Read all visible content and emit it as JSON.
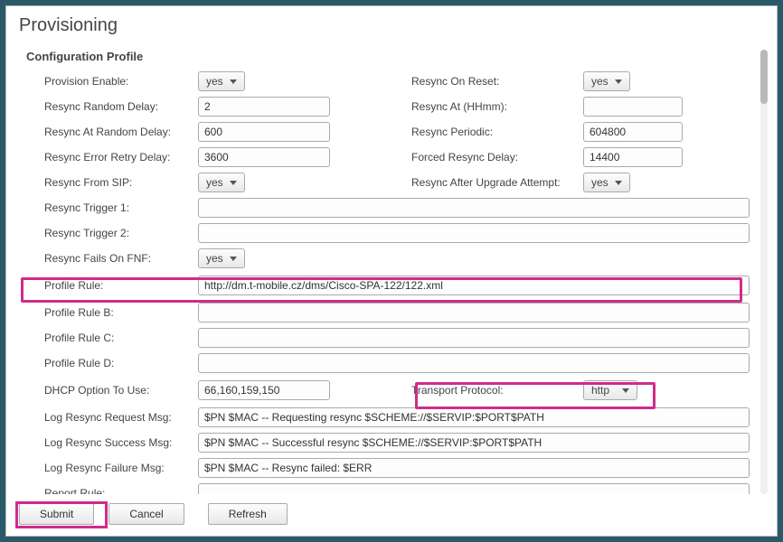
{
  "title": "Provisioning",
  "section": "Configuration Profile",
  "options": {
    "yes": "yes",
    "http": "http"
  },
  "labels": {
    "provisionEnable": "Provision Enable:",
    "resyncOnReset": "Resync On Reset:",
    "resyncRandomDelay": "Resync Random Delay:",
    "resyncAt": "Resync At (HHmm):",
    "resyncAtRandomDelay": "Resync At Random Delay:",
    "resyncPeriodic": "Resync Periodic:",
    "resyncErrorRetryDelay": "Resync Error Retry Delay:",
    "forcedResyncDelay": "Forced Resync Delay:",
    "resyncFromSip": "Resync From SIP:",
    "resyncAfterUpgrade": "Resync After Upgrade Attempt:",
    "resyncTrigger1": "Resync Trigger 1:",
    "resyncTrigger2": "Resync Trigger 2:",
    "resyncFailsOnFnf": "Resync Fails On FNF:",
    "profileRule": "Profile Rule:",
    "profileRuleB": "Profile Rule B:",
    "profileRuleC": "Profile Rule C:",
    "profileRuleD": "Profile Rule D:",
    "dhcpOption": "DHCP Option To Use:",
    "transportProtocol": "Transport Protocol:",
    "logReq": "Log Resync Request Msg:",
    "logSucc": "Log Resync Success Msg:",
    "logFail": "Log Resync Failure Msg:",
    "reportRule": "Report Rule:"
  },
  "values": {
    "resyncRandomDelay": "2",
    "resyncAt": "",
    "resyncAtRandomDelay": "600",
    "resyncPeriodic": "604800",
    "resyncErrorRetryDelay": "3600",
    "forcedResyncDelay": "14400",
    "resyncTrigger1": "",
    "resyncTrigger2": "",
    "profileRule": "http://dm.t-mobile.cz/dms/Cisco-SPA-122/122.xml",
    "profileRuleB": "",
    "profileRuleC": "",
    "profileRuleD": "",
    "dhcpOption": "66,160,159,150",
    "logReq": "$PN $MAC -- Requesting resync $SCHEME://$SERVIP:$PORT$PATH",
    "logSucc": "$PN $MAC -- Successful resync $SCHEME://$SERVIP:$PORT$PATH",
    "logFail": "$PN $MAC -- Resync failed: $ERR",
    "reportRule": ""
  },
  "buttons": {
    "submit": "Submit",
    "cancel": "Cancel",
    "refresh": "Refresh"
  },
  "highlighted": [
    "profileRule",
    "transportProtocol",
    "submit"
  ]
}
